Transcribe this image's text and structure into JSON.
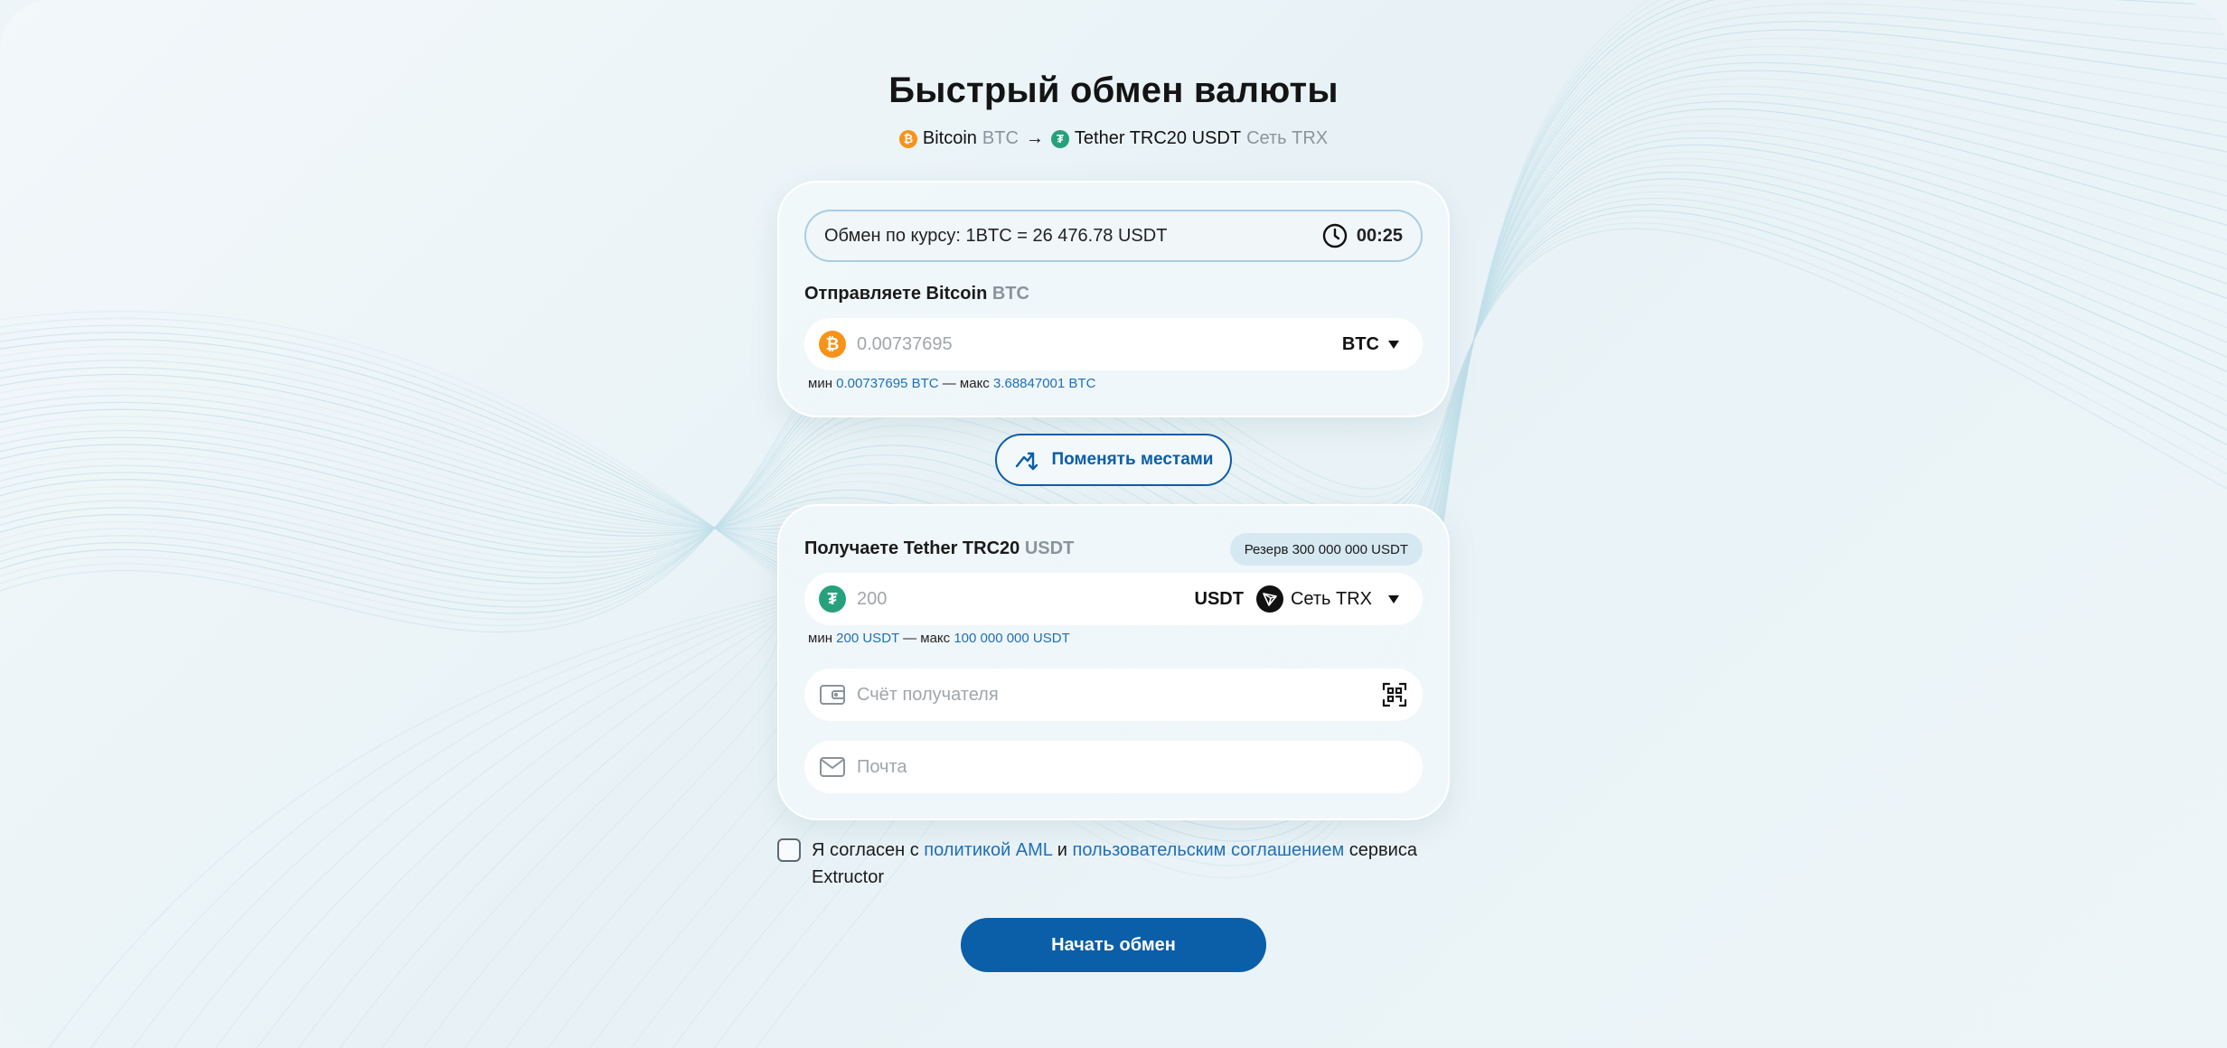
{
  "page": {
    "title": "Быстрый обмен валюты"
  },
  "route": {
    "from_name": "Bitcoin",
    "from_ticker": "BTC",
    "arrow": "→",
    "to_name": "Tether TRC20 USDT",
    "to_network": "Сеть TRX"
  },
  "rate": {
    "text": "Обмен по курсу: 1BTC = 26 476.78 USDT",
    "timer": "00:25"
  },
  "send": {
    "label": "Отправляете Bitcoin",
    "label_ticker": "BTC",
    "amount_placeholder": "0.00737695",
    "currency": "BTC",
    "limits_min_prefix": "мин",
    "limits_min": "0.00737695 BTC",
    "limits_sep": "— макс",
    "limits_max": "3.68847001 BTC"
  },
  "swap_button": {
    "label": "Поменять местами"
  },
  "receive": {
    "label": "Получаете Tether TRC20",
    "label_ticker": "USDT",
    "reserve": "Резерв 300 000 000 USDT",
    "amount_placeholder": "200",
    "currency": "USDT",
    "network": "Сеть TRX",
    "limits_min_prefix": "мин",
    "limits_min": "200 USDT",
    "limits_sep": "— макс",
    "limits_max": "100 000 000 USDT",
    "account_placeholder": "Счёт получателя",
    "email_placeholder": "Почта"
  },
  "agreement": {
    "prefix": "Я согласен с",
    "aml_link": "политикой AML",
    "and": "и",
    "terms_link": "пользовательским соглашением",
    "suffix": "сервиса Extructor"
  },
  "start_button": {
    "label": "Начать обмен"
  },
  "colors": {
    "accent": "#0b5ea8",
    "link": "#1f6fb8",
    "btc": "#f7931a",
    "usdt": "#26a17b"
  },
  "icons": {
    "btc": "bitcoin-icon",
    "usdt": "tether-icon",
    "clock": "clock-icon",
    "swap": "swap-arrows-icon",
    "tron": "tron-icon",
    "wallet": "wallet-icon",
    "qr": "qr-scan-icon",
    "mail": "mail-icon"
  }
}
